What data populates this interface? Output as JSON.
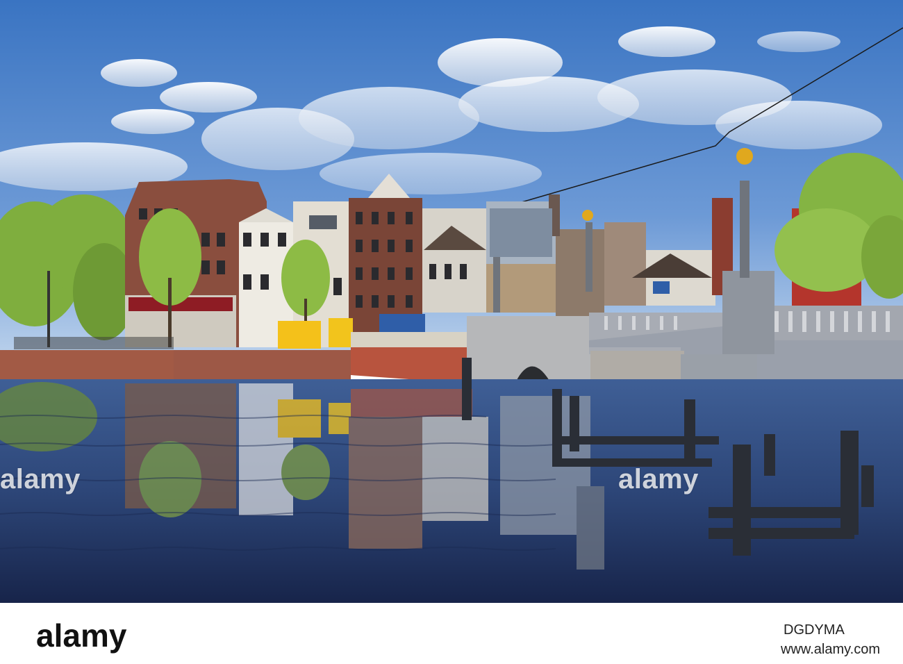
{
  "photo": {
    "subject": "Amsterdam canal with historic houses and stone bridge",
    "palette": {
      "sky_top": "#3d79c6",
      "sky_bottom": "#b6cdea",
      "water_top": "#3e5d93",
      "water_bottom": "#1b2b56",
      "brick": "#8e4b3a",
      "bridge_stone": "#a9aeb8",
      "tree_green": "#8bb54a",
      "yellow_container": "#f6c21a",
      "blue_container": "#2f5ea8"
    }
  },
  "watermarks": {
    "left": "alamy",
    "right": "alamy"
  },
  "footer": {
    "logo": "alamy",
    "image_id": "DGDYMA",
    "url": "www.alamy.com"
  }
}
